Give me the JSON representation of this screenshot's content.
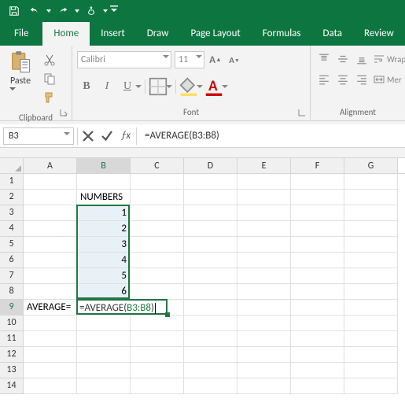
{
  "qat": {
    "items": [
      "save",
      "undo",
      "redo",
      "touch",
      "customize"
    ]
  },
  "tabs": [
    "File",
    "Home",
    "Insert",
    "Draw",
    "Page Layout",
    "Formulas",
    "Data",
    "Review"
  ],
  "active_tab": "Home",
  "ribbon": {
    "clipboard": {
      "label": "Clipboard",
      "paste": "Paste"
    },
    "font": {
      "label": "Font",
      "name": "Calibri",
      "size": "11",
      "buttons": {
        "bold": "B",
        "italic": "I",
        "underline": "U"
      },
      "increase": "A",
      "decrease": "A"
    },
    "alignment": {
      "label": "Alignment",
      "wrap": "Wrap",
      "merge": "Mer"
    }
  },
  "namebox": "B3",
  "formula_bar": "=AVERAGE(B3:B8)",
  "columns": [
    "A",
    "B",
    "C",
    "D",
    "E",
    "F",
    "G"
  ],
  "grid": {
    "rows": 14,
    "cells": {
      "B2": "NUMBERS",
      "B3": "1",
      "B4": "2",
      "B5": "3",
      "B6": "4",
      "B7": "5",
      "B8": "6",
      "A9": "AVERAGE="
    },
    "numeric": [
      "B3",
      "B4",
      "B5",
      "B6",
      "B7",
      "B8"
    ],
    "selected_blue": [
      "B3",
      "B4",
      "B5",
      "B6",
      "B7",
      "B8"
    ],
    "active_cols": [
      "B"
    ],
    "active_rows": [
      9
    ]
  },
  "editing": {
    "cell": "B9",
    "prefix": "=AVERAGE(",
    "ref": "B3:B8",
    "suffix": ")"
  },
  "chart_data": {
    "type": "table",
    "title": "NUMBERS",
    "categories": [
      "B3",
      "B4",
      "B5",
      "B6",
      "B7",
      "B8"
    ],
    "values": [
      1,
      2,
      3,
      4,
      5,
      6
    ],
    "formula": "=AVERAGE(B3:B8)"
  }
}
